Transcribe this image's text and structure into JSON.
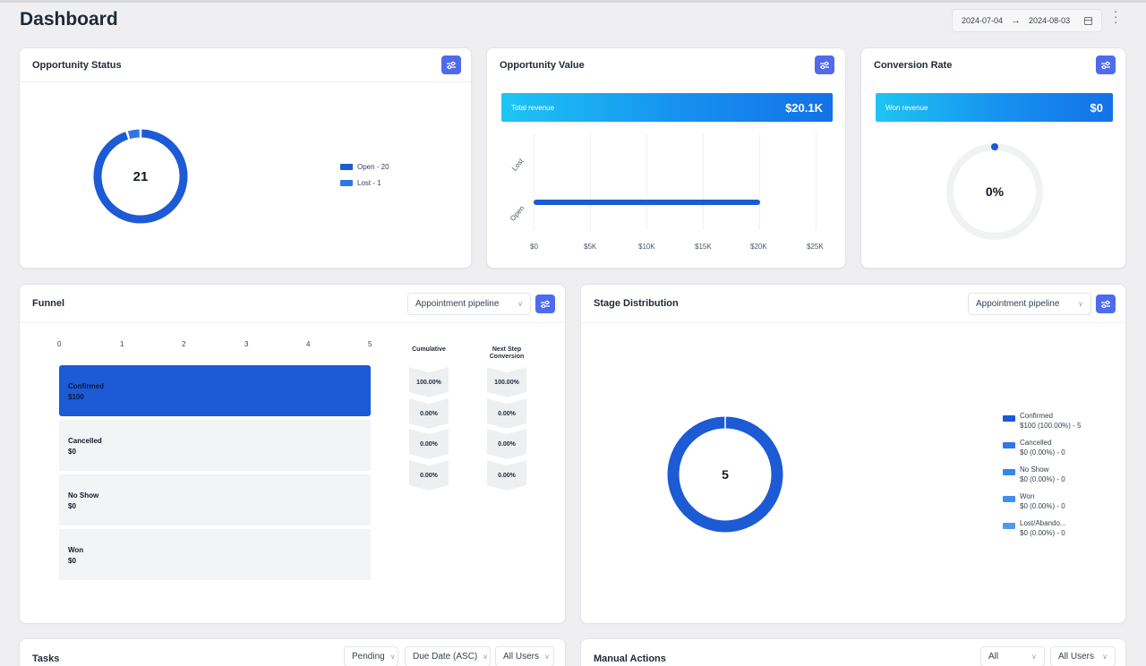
{
  "page": {
    "title": "Dashboard",
    "date_start": "2024-07-04",
    "date_arrow": "→",
    "date_end": "2024-08-03",
    "more_icon": "kebab-menu-icon"
  },
  "colors": {
    "accent": "#4f6bed",
    "chart_blue": "#1c5ad6",
    "chart_light_blue": "#2e77e5",
    "banner_start": "#1ec5f3",
    "banner_end": "#1371e6"
  },
  "opportunity_status": {
    "title": "Opportunity Status",
    "center_value": "21",
    "legend": [
      {
        "label": "Open - 20",
        "color": "#1c5ad6"
      },
      {
        "label": "Lost - 1",
        "color": "#2e77e5"
      }
    ]
  },
  "opportunity_value": {
    "title": "Opportunity Value",
    "banner_label": "Total revenue",
    "banner_value": "$20.1K"
  },
  "conversion_rate": {
    "title": "Conversion Rate",
    "banner_label": "Won revenue",
    "banner_value": "$0",
    "center_value": "0%",
    "rate": 0
  },
  "funnel": {
    "title": "Funnel",
    "pipeline": "Appointment pipeline",
    "ticks": [
      "0",
      "1",
      "2",
      "3",
      "4",
      "5"
    ],
    "col_cumulative": "Cumulative",
    "col_next_step_1": "Next Step",
    "col_next_step_2": "Conversion",
    "stages": [
      {
        "stage": "Confirmed",
        "amount": "$100",
        "cumulative": "100.00%",
        "next": "100.00%"
      },
      {
        "stage": "Cancelled",
        "amount": "$0",
        "cumulative": "0.00%",
        "next": "0.00%"
      },
      {
        "stage": "No Show",
        "amount": "$0",
        "cumulative": "0.00%",
        "next": "0.00%"
      },
      {
        "stage": "Won",
        "amount": "$0",
        "cumulative": "0.00%",
        "next": "0.00%"
      }
    ]
  },
  "stage_distribution": {
    "title": "Stage Distribution",
    "pipeline": "Appointment pipeline",
    "center_value": "5",
    "legend": [
      {
        "name": "Confirmed",
        "detail": "$100 (100.00%) - 5",
        "color": "#1c5ad6"
      },
      {
        "name": "Cancelled",
        "detail": "$0 (0.00%) - 0",
        "color": "#2e77e5"
      },
      {
        "name": "No Show",
        "detail": "$0 (0.00%) - 0",
        "color": "#3585ea"
      },
      {
        "name": "Won",
        "detail": "$0 (0.00%) - 0",
        "color": "#4190ee"
      },
      {
        "name": "Lost/Abando...",
        "detail": "$0 (0.00%) - 0",
        "color": "#4f9af0"
      }
    ]
  },
  "tasks": {
    "title": "Tasks",
    "filter_status": "Pending",
    "filter_sort": "Due Date (ASC)",
    "filter_users": "All Users"
  },
  "manual_actions": {
    "title": "Manual Actions",
    "filter_type": "All",
    "filter_users": "All Users"
  },
  "chart_data": [
    {
      "type": "pie",
      "title": "Opportunity Status",
      "categories": [
        "Open",
        "Lost"
      ],
      "values": [
        20,
        1
      ]
    },
    {
      "type": "bar",
      "title": "Opportunity Value",
      "categories": [
        "Open",
        "Lost"
      ],
      "values": [
        20100,
        0
      ],
      "xticks": [
        "$0",
        "$5K",
        "$10K",
        "$15K",
        "$20K",
        "$25K"
      ],
      "xlim": [
        0,
        25000
      ],
      "orientation": "horizontal",
      "grid": true
    },
    {
      "type": "bar",
      "title": "Funnel",
      "categories": [
        "Confirmed",
        "Cancelled",
        "No Show",
        "Won"
      ],
      "values": [
        5,
        0,
        0,
        0
      ],
      "xlim": [
        0,
        5
      ],
      "orientation": "horizontal"
    },
    {
      "type": "pie",
      "title": "Stage Distribution",
      "categories": [
        "Confirmed",
        "Cancelled",
        "No Show",
        "Won",
        "Lost/Abando..."
      ],
      "values": [
        5,
        0,
        0,
        0,
        0
      ]
    }
  ]
}
